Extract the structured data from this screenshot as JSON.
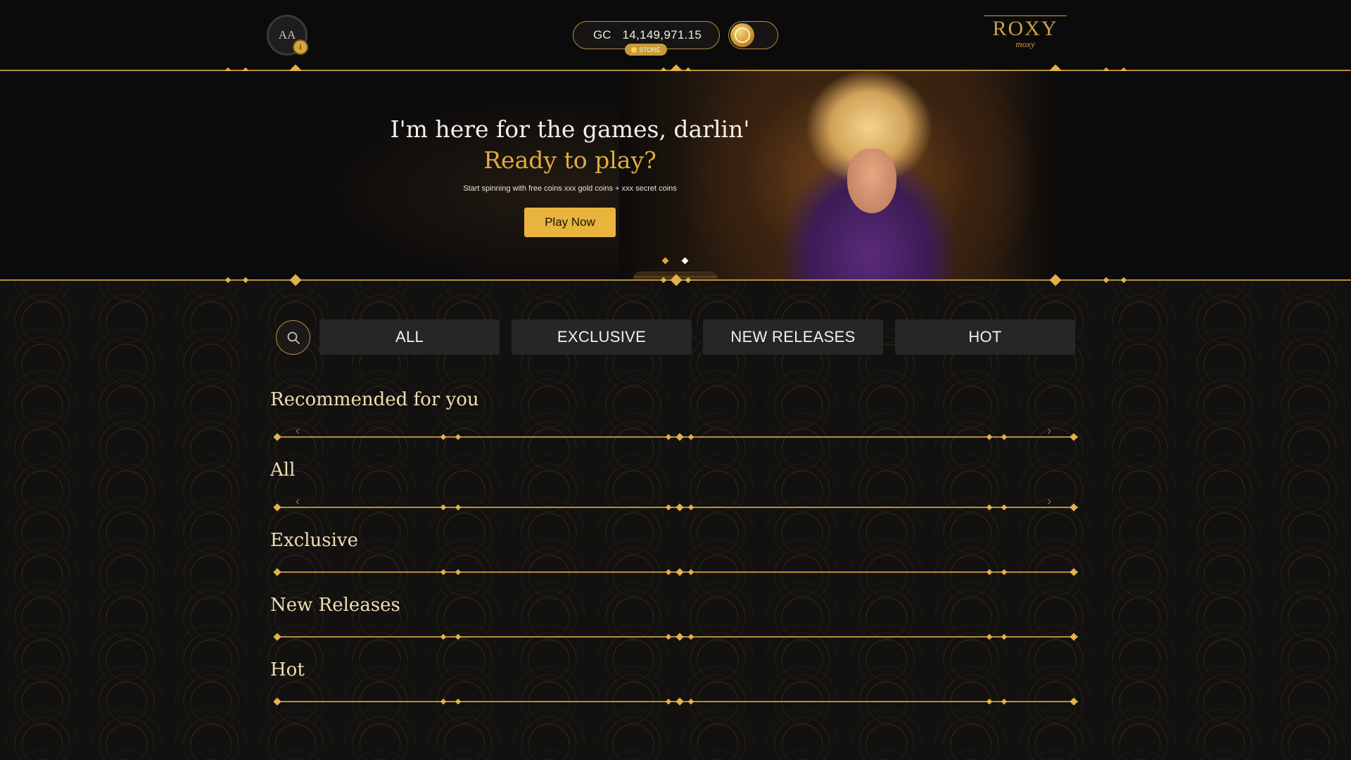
{
  "header": {
    "avatar_initials": "AA",
    "avatar_badge": "i",
    "balance": {
      "currency": "GC",
      "amount": "14,149,971.15"
    },
    "store_label": "STORE",
    "logo": {
      "main": "ROXY",
      "sub": "moxy"
    }
  },
  "hero": {
    "title": "I'm here for the games, darlin'",
    "subtitle": "Ready to play?",
    "description": "Start spinning with free coins xxx gold coins + xxx secret coins",
    "cta_label": "Play Now",
    "slides_total": 2,
    "active_slide": 2
  },
  "tabs": [
    {
      "label": "ALL"
    },
    {
      "label": "EXCLUSIVE"
    },
    {
      "label": "NEW RELEASES"
    },
    {
      "label": "HOT"
    }
  ],
  "sections": [
    {
      "title": "Recommended for you"
    },
    {
      "title": "All"
    },
    {
      "title": "Exclusive"
    },
    {
      "title": "New Releases"
    },
    {
      "title": "Hot"
    }
  ],
  "icons": {
    "search": "search-icon",
    "arrow_left": "chevron-left-icon",
    "arrow_right": "chevron-right-icon",
    "coin": "coin-icon"
  },
  "colors": {
    "gold": "#b88c3c",
    "accent_gold": "#e8b43e",
    "background": "#0c0b0b",
    "tab_bg": "#262626",
    "section_title": "#f0ddb2"
  }
}
